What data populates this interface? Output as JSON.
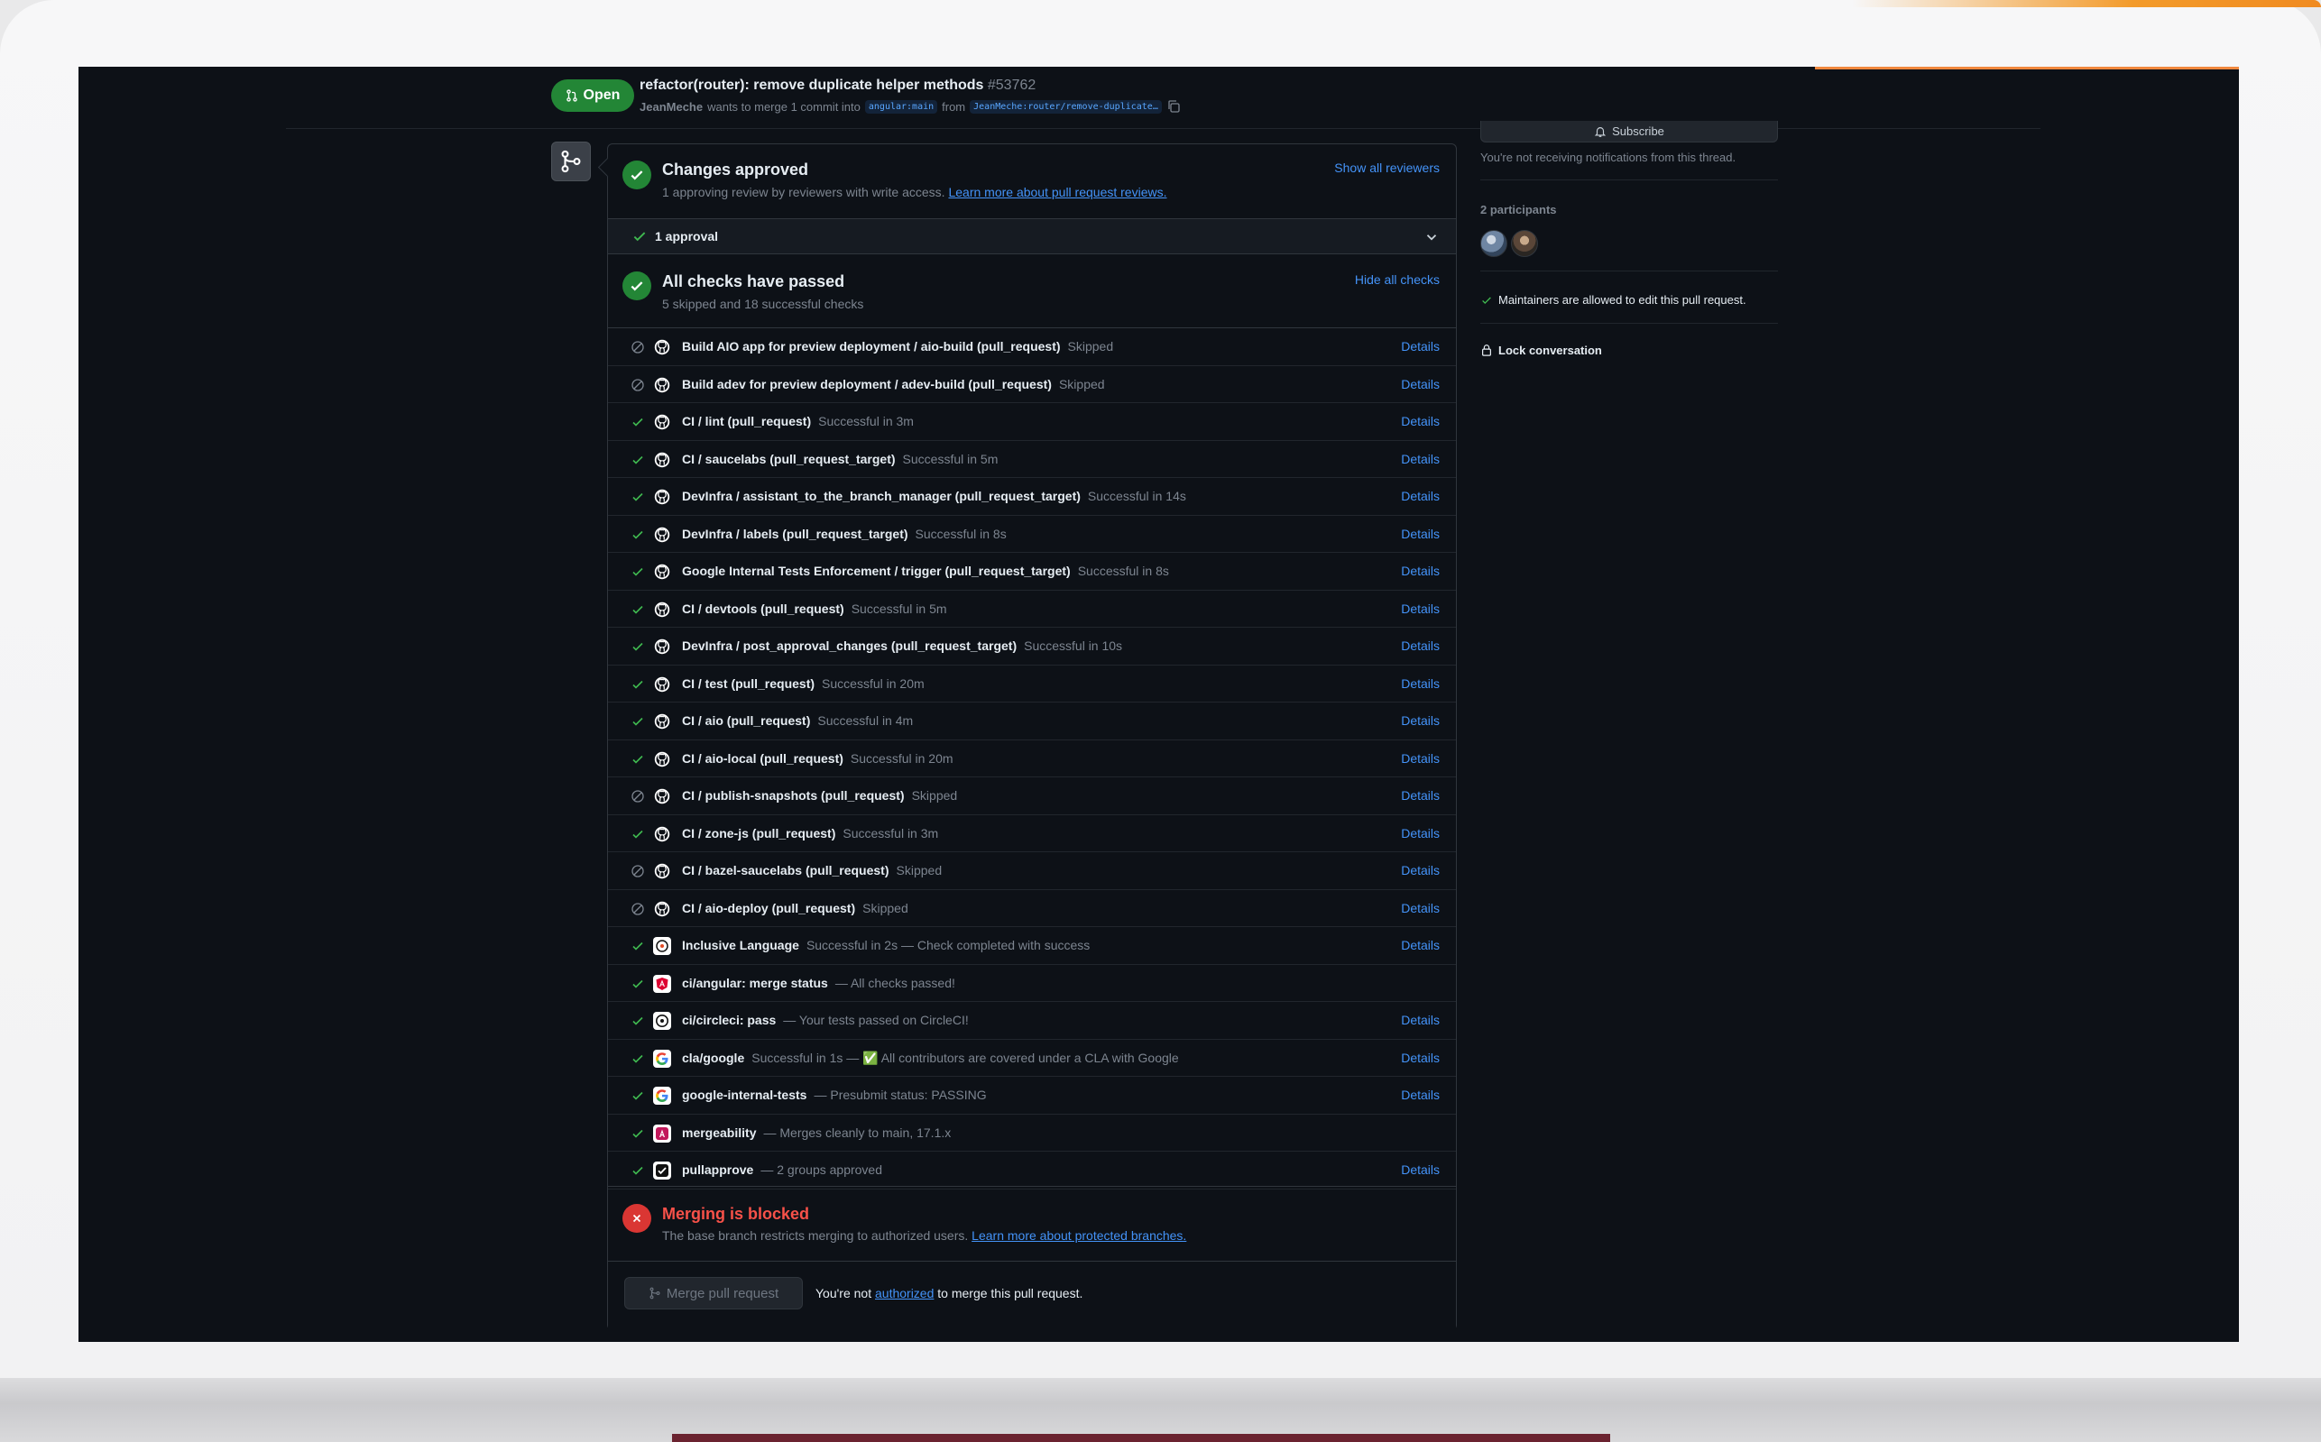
{
  "pr": {
    "status": "Open",
    "title": "refactor(router): remove duplicate helper methods",
    "number": "#53762",
    "author": "JeanMeche",
    "merge_text": "wants to merge 1 commit into",
    "base_branch": "angular:main",
    "from_text": "from",
    "head_branch": "JeanMeche:router/remove-duplicate…"
  },
  "approved": {
    "title": "Changes approved",
    "subtitle": "1 approving review by reviewers with write access.",
    "learn_link": "Learn more about pull request reviews.",
    "show_reviewers": "Show all reviewers",
    "approval_count": "1 approval"
  },
  "checks": {
    "title": "All checks have passed",
    "subtitle": "5 skipped and 18 successful checks",
    "hide_link": "Hide all checks",
    "details_label": "Details",
    "items": [
      {
        "status": "skipped",
        "icon": "github",
        "name": "Build AIO app for preview deployment / aio-build (pull_request)",
        "desc": "Skipped",
        "details": true
      },
      {
        "status": "skipped",
        "icon": "github",
        "name": "Build adev for preview deployment / adev-build (pull_request)",
        "desc": "Skipped",
        "details": true
      },
      {
        "status": "success",
        "icon": "github",
        "name": "CI / lint (pull_request)",
        "desc": "Successful in 3m",
        "details": true
      },
      {
        "status": "success",
        "icon": "github",
        "name": "CI / saucelabs (pull_request_target)",
        "desc": "Successful in 5m",
        "details": true
      },
      {
        "status": "success",
        "icon": "github",
        "name": "DevInfra / assistant_to_the_branch_manager (pull_request_target)",
        "desc": "Successful in 14s",
        "details": true
      },
      {
        "status": "success",
        "icon": "github",
        "name": "DevInfra / labels (pull_request_target)",
        "desc": "Successful in 8s",
        "details": true
      },
      {
        "status": "success",
        "icon": "github",
        "name": "Google Internal Tests Enforcement / trigger (pull_request_target)",
        "desc": "Successful in 8s",
        "details": true
      },
      {
        "status": "success",
        "icon": "github",
        "name": "CI / devtools (pull_request)",
        "desc": "Successful in 5m",
        "details": true
      },
      {
        "status": "success",
        "icon": "github",
        "name": "DevInfra / post_approval_changes (pull_request_target)",
        "desc": "Successful in 10s",
        "details": true
      },
      {
        "status": "success",
        "icon": "github",
        "name": "CI / test (pull_request)",
        "desc": "Successful in 20m",
        "details": true
      },
      {
        "status": "success",
        "icon": "github",
        "name": "CI / aio (pull_request)",
        "desc": "Successful in 4m",
        "details": true
      },
      {
        "status": "success",
        "icon": "github",
        "name": "CI / aio-local (pull_request)",
        "desc": "Successful in 20m",
        "details": true
      },
      {
        "status": "skipped",
        "icon": "github",
        "name": "CI / publish-snapshots (pull_request)",
        "desc": "Skipped",
        "details": true
      },
      {
        "status": "success",
        "icon": "github",
        "name": "CI / zone-js (pull_request)",
        "desc": "Successful in 3m",
        "details": true
      },
      {
        "status": "skipped",
        "icon": "github",
        "name": "CI / bazel-saucelabs (pull_request)",
        "desc": "Skipped",
        "details": true
      },
      {
        "status": "skipped",
        "icon": "github",
        "name": "CI / aio-deploy (pull_request)",
        "desc": "Skipped",
        "details": true
      },
      {
        "status": "success",
        "icon": "inclusive",
        "name": "Inclusive Language",
        "desc": "Successful in 2s — Check completed with success",
        "details": true
      },
      {
        "status": "success",
        "icon": "angular",
        "name": "ci/angular: merge status",
        "desc": "— All checks passed!",
        "details": false
      },
      {
        "status": "success",
        "icon": "circleci",
        "name": "ci/circleci: pass",
        "desc": "— Your tests passed on CircleCI!",
        "details": true
      },
      {
        "status": "success",
        "icon": "google",
        "name": "cla/google",
        "desc": "Successful in 1s — ✅ All contributors are covered under a CLA with Google",
        "details": true
      },
      {
        "status": "success",
        "icon": "google",
        "name": "google-internal-tests",
        "desc": "— Presubmit status: PASSING",
        "details": true
      },
      {
        "status": "success",
        "icon": "mergeability",
        "name": "mergeability",
        "desc": "— Merges cleanly to main, 17.1.x",
        "details": false
      },
      {
        "status": "success",
        "icon": "pullapprove",
        "name": "pullapprove",
        "desc": "— 2 groups approved",
        "details": true
      }
    ]
  },
  "blocked": {
    "title": "Merging is blocked",
    "subtitle": "The base branch restricts merging to authorized users.",
    "learn_link": "Learn more about protected branches.",
    "merge_button": "Merge pull request",
    "note_prefix": "You're not",
    "note_link": "authorized",
    "note_suffix": "to merge this pull request."
  },
  "sidebar": {
    "subscribe": "Subscribe",
    "notification_note": "You're not receiving notifications from this thread.",
    "participants": "2 participants",
    "maintainers_note": "Maintainers are allowed to edit this pull request.",
    "lock": "Lock conversation"
  },
  "colors": {
    "background": "#0d1117",
    "success": "#238636",
    "danger": "#da3633",
    "link": "#4493f8"
  }
}
